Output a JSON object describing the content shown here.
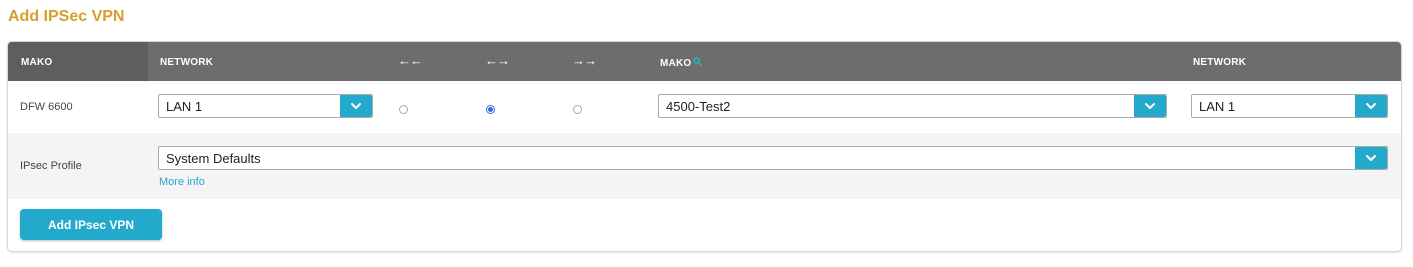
{
  "page": {
    "title": "Add IPSec VPN"
  },
  "header": {
    "mako_left": "MAKO",
    "network_left": "NETWORK",
    "dir_left_icon": "←←",
    "dir_both_icon": "←→",
    "dir_right_icon": "→→",
    "mako_right": "MAKO",
    "search_icon": "search-icon",
    "network_right": "NETWORK"
  },
  "row1": {
    "mako_name": "DFW 6600",
    "network_left": {
      "value": "LAN 1"
    },
    "direction": {
      "options": [
        "left",
        "both",
        "right"
      ],
      "selected": "both"
    },
    "mako_right": {
      "value": "4500-Test2"
    },
    "network_right": {
      "value": "LAN 1"
    }
  },
  "row2": {
    "label": "IPsec Profile",
    "profile": {
      "value": "System Defaults"
    },
    "more_info": "More info"
  },
  "actions": {
    "add_button": "Add IPsec VPN"
  },
  "colors": {
    "title": "#d4a02a",
    "header_bg": "#6d6d6d",
    "accent": "#23a9cb",
    "radio_selected": "#2a6de1"
  }
}
